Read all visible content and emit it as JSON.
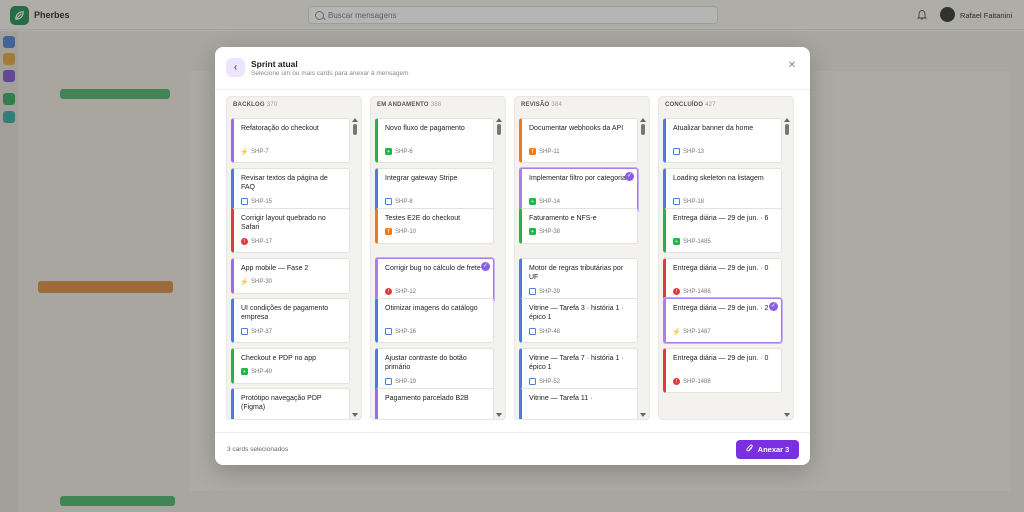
{
  "app": {
    "name": "Pherbes",
    "logo_icon": "leaf-icon",
    "brand_color": "#1e8a4c"
  },
  "search": {
    "placeholder": "Buscar mensagens"
  },
  "user": {
    "name": "Rafael Faitanini"
  },
  "modal": {
    "title": "Sprint atual",
    "subtitle": "Selecione um ou mais cards para anexar à mensagem",
    "footer_status": "3 cards selecionados",
    "attach_label": "Anexar 3",
    "accent_color": "#7a2fe0"
  },
  "columns": [
    {
      "title": "BACKLOG",
      "count": "370",
      "cards": [
        {
          "title": "Refatoração do checkout",
          "type": "epic",
          "id": "SHP-7",
          "color": "#9a6cf0",
          "selected": false
        },
        {
          "title": "Revisar textos da página de FAQ",
          "type": "story",
          "id": "SHP-15",
          "color": "#4b7be0",
          "selected": false
        },
        {
          "title": "Corrigir layout quebrado no Safari",
          "type": "bug",
          "id": "SHP-17",
          "color": "#e03a3a",
          "selected": false
        },
        {
          "title": "App mobile — Fase 2",
          "type": "epic",
          "id": "SHP-30",
          "color": "#9a6cf0",
          "selected": false
        },
        {
          "title": "UI condições de pagamento empresa",
          "type": "story",
          "id": "SHP-37",
          "color": "#4b7be0",
          "selected": false
        },
        {
          "title": "Checkout e PDP no app",
          "type": "improve",
          "id": "SHP-40",
          "color": "#27b24a",
          "selected": false
        },
        {
          "title": "Protótipo navegação PDP (Figma)",
          "type": "story",
          "id": "",
          "color": "#4b7be0",
          "selected": false
        }
      ]
    },
    {
      "title": "EM ANDAMENTO",
      "count": "388",
      "cards": [
        {
          "title": "Novo fluxo de pagamento",
          "type": "improve",
          "id": "SHP-6",
          "color": "#27b24a",
          "selected": false
        },
        {
          "title": "Integrar gateway Stripe",
          "type": "story",
          "id": "SHP-8",
          "color": "#4b7be0",
          "selected": false
        },
        {
          "title": "Testes E2E do checkout",
          "type": "task",
          "id": "SHP-10",
          "color": "#f07a1a",
          "selected": false
        },
        {
          "title": "Corrigir bug no cálculo de frete",
          "type": "bug",
          "id": "SHP-12",
          "color": "#e03a3a",
          "selected": true
        },
        {
          "title": "Otimizar imagens do catálogo",
          "type": "story",
          "id": "SHP-16",
          "color": "#4b7be0",
          "selected": false
        },
        {
          "title": "Ajustar contraste do botão primário",
          "type": "story",
          "id": "SHP-19",
          "color": "#4b7be0",
          "selected": false
        },
        {
          "title": "Pagamento parcelado B2B",
          "type": "epic",
          "id": "",
          "color": "#9a6cf0",
          "selected": false
        }
      ]
    },
    {
      "title": "REVISÃO",
      "count": "384",
      "cards": [
        {
          "title": "Documentar webhooks da API",
          "type": "task",
          "id": "SHP-11",
          "color": "#f07a1a",
          "selected": false
        },
        {
          "title": "Implementar filtro por categoria",
          "type": "improve",
          "id": "SHP-14",
          "color": "#27b24a",
          "selected": true
        },
        {
          "title": "Faturamento e NFS-e",
          "type": "improve",
          "id": "SHP-38",
          "color": "#27b24a",
          "selected": false
        },
        {
          "title": "Motor de regras tributárias por UF",
          "type": "story",
          "id": "SHP-39",
          "color": "#4b7be0",
          "selected": false
        },
        {
          "title": "Vitrine — Tarefa 3 · história 1 · épico 1",
          "type": "story",
          "id": "SHP-48",
          "color": "#4b7be0",
          "selected": false
        },
        {
          "title": "Vitrine — Tarefa 7 · história 1 · épico 1",
          "type": "story",
          "id": "SHP-52",
          "color": "#4b7be0",
          "selected": false
        },
        {
          "title": "Vitrine — Tarefa 11 ·",
          "type": "story",
          "id": "",
          "color": "#4b7be0",
          "selected": false
        }
      ]
    },
    {
      "title": "CONCLUÍDO",
      "count": "427",
      "cards": [
        {
          "title": "Atualizar banner da home",
          "type": "story",
          "id": "SHP-13",
          "color": "#4b7be0",
          "selected": false
        },
        {
          "title": "Loading skeleton na listagem",
          "type": "story",
          "id": "SHP-18",
          "color": "#4b7be0",
          "selected": false
        },
        {
          "title": "Entrega diária — 29 de jun. · 6",
          "type": "improve",
          "id": "SHP-1485",
          "color": "#27b24a",
          "selected": false
        },
        {
          "title": "Entrega diária — 29 de jun. · 0",
          "type": "bug",
          "id": "SHP-1486",
          "color": "#e03a3a",
          "selected": false
        },
        {
          "title": "Entrega diária — 29 de jun. · 2",
          "type": "epic",
          "id": "SHP-1487",
          "color": "#9a6cf0",
          "selected": true
        },
        {
          "title": "Entrega diária — 29 de jun. · 0",
          "type": "bug",
          "id": "SHP-1488",
          "color": "#e03a3a",
          "selected": false
        }
      ]
    }
  ]
}
